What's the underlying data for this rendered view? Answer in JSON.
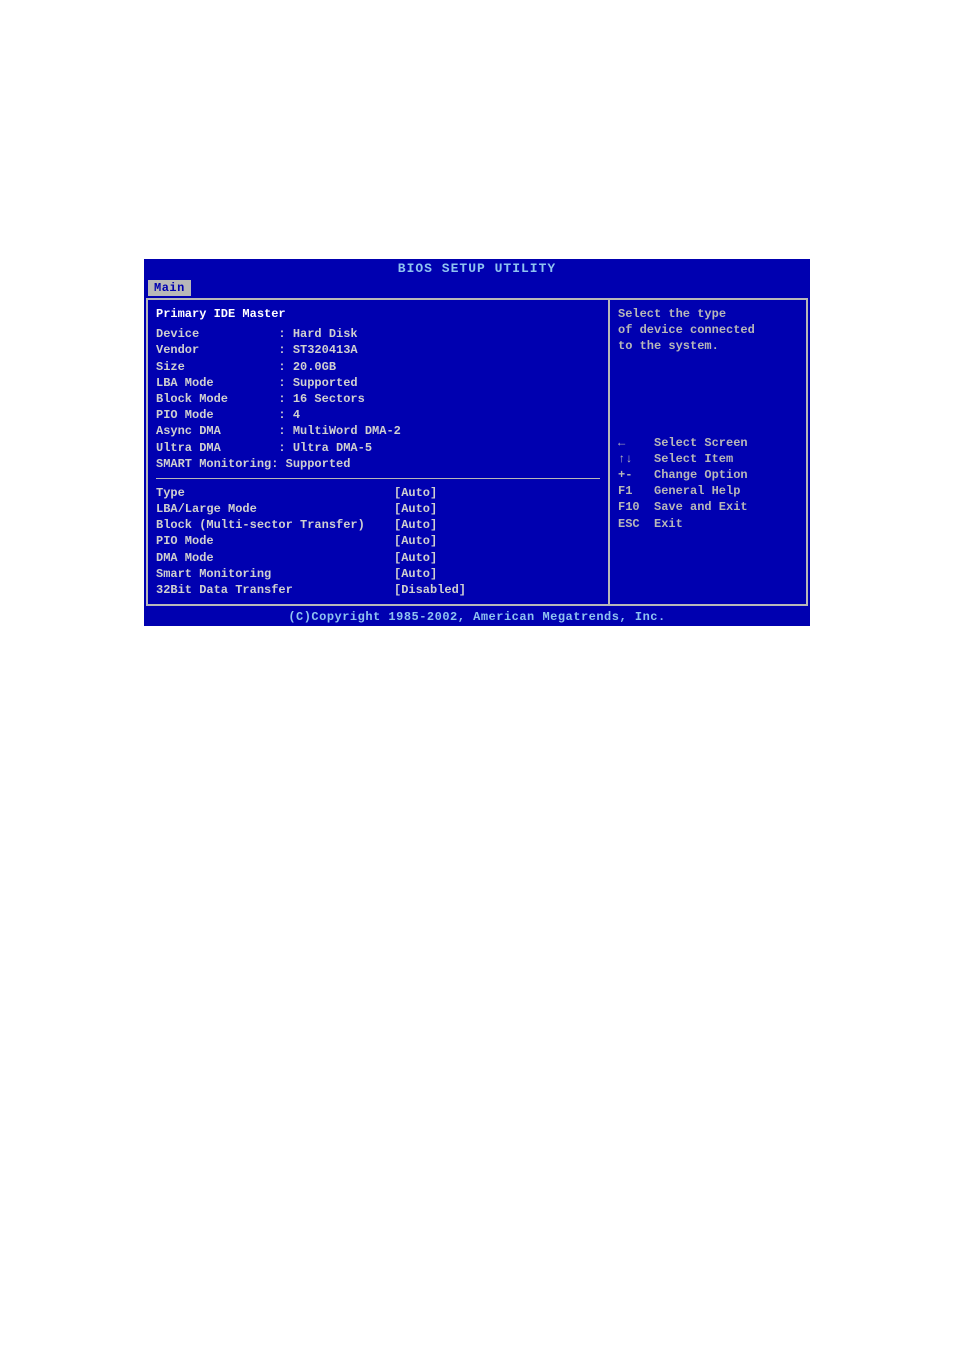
{
  "title": "BIOS SETUP UTILITY",
  "tab": "Main",
  "section_heading": "Primary IDE Master",
  "info": {
    "device": "Device           : Hard Disk",
    "vendor": "Vendor           : ST320413A",
    "size": "Size             : 20.0GB",
    "lba_mode": "LBA Mode         : Supported",
    "block_mode": "Block Mode       : 16 Sectors",
    "pio_mode": "PIO Mode         : 4",
    "async_dma": "Async DMA        : MultiWord DMA-2",
    "ultra_dma": "Ultra DMA        : Ultra DMA-5",
    "smart": "SMART Monitoring: Supported"
  },
  "settings": [
    {
      "label": "Type",
      "value": "[Auto]"
    },
    {
      "label": "LBA/Large Mode",
      "value": "[Auto]"
    },
    {
      "label": "Block (Multi-sector Transfer)",
      "value": "[Auto]"
    },
    {
      "label": "PIO Mode",
      "value": "[Auto]"
    },
    {
      "label": "DMA Mode",
      "value": "[Auto]"
    },
    {
      "label": "Smart Monitoring",
      "value": "[Auto]"
    },
    {
      "label": "32Bit Data Transfer",
      "value": "[Disabled]"
    }
  ],
  "help": {
    "line1": "Select the type",
    "line2": "of device connected",
    "line3": "to the system."
  },
  "nav": [
    {
      "key_icon": "←",
      "desc": "Select Screen"
    },
    {
      "key_icon": "↑↓",
      "desc": "Select Item"
    },
    {
      "key": "+-",
      "desc": "Change Option"
    },
    {
      "key": "F1",
      "desc": "General Help"
    },
    {
      "key": "F10",
      "desc": "Save and Exit"
    },
    {
      "key": "ESC",
      "desc": "Exit"
    }
  ],
  "copyright": "(C)Copyright 1985-2002, American Megatrends, Inc."
}
